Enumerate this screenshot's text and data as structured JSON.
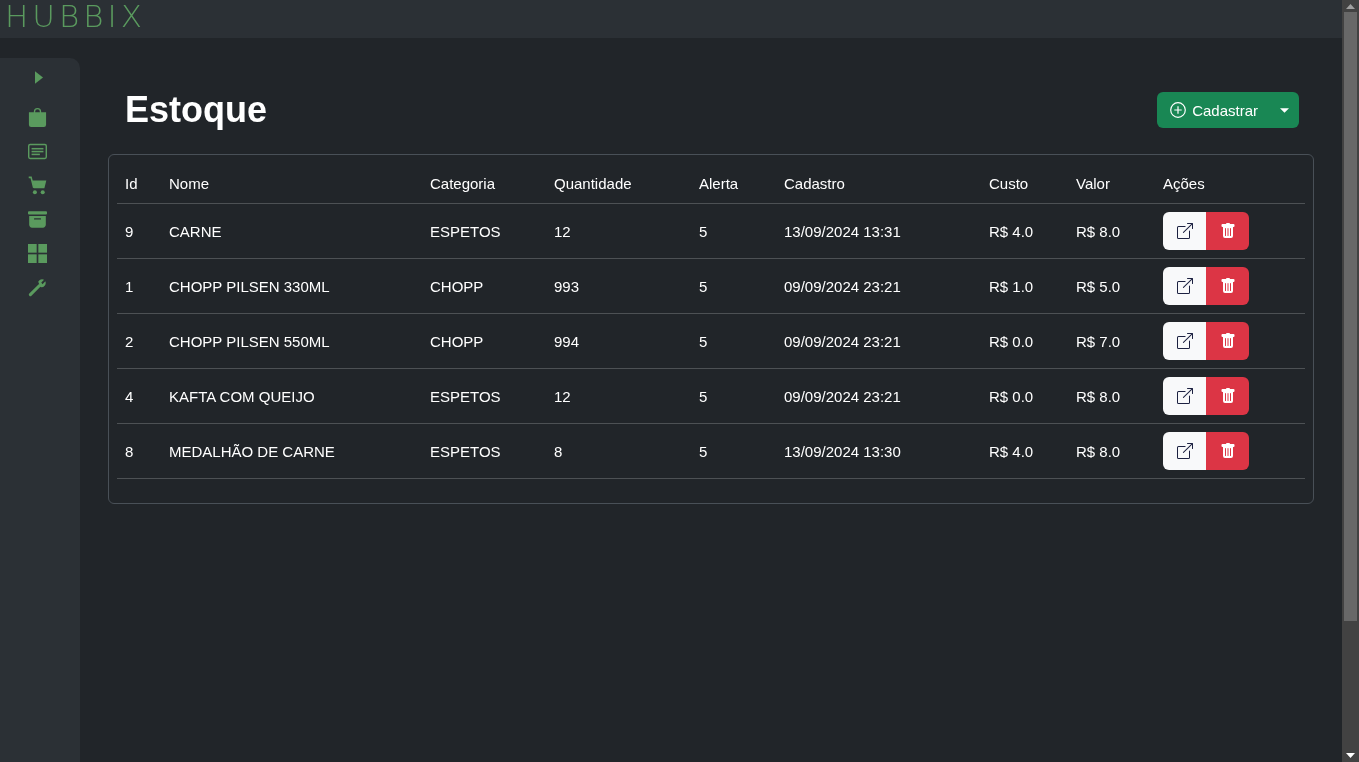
{
  "topbar": {
    "logo": "HUBBIX"
  },
  "page": {
    "title": "Estoque",
    "register_button": {
      "label": "Cadastrar"
    }
  },
  "table": {
    "columns": [
      "Id",
      "Nome",
      "Categoria",
      "Quantidade",
      "Alerta",
      "Cadastro",
      "Custo",
      "Valor",
      "Ações"
    ],
    "rows": [
      [
        "9",
        "CARNE",
        "ESPETOS",
        "12",
        "5",
        "13/09/2024 13:31",
        "R$ 4.0",
        "R$ 8.0"
      ],
      [
        "1",
        "CHOPP PILSEN 330ML",
        "CHOPP",
        "993",
        "5",
        "09/09/2024 23:21",
        "R$ 1.0",
        "R$ 5.0"
      ],
      [
        "2",
        "CHOPP PILSEN 550ML",
        "CHOPP",
        "994",
        "5",
        "09/09/2024 23:21",
        "R$ 0.0",
        "R$ 7.0"
      ],
      [
        "4",
        "KAFTA COM QUEIJO",
        "ESPETOS",
        "12",
        "5",
        "09/09/2024 23:21",
        "R$ 0.0",
        "R$ 8.0"
      ],
      [
        "8",
        "MEDALHÃO DE CARNE",
        "ESPETOS",
        "8",
        "5",
        "13/09/2024 13:30",
        "R$ 4.0",
        "R$ 8.0"
      ]
    ]
  }
}
